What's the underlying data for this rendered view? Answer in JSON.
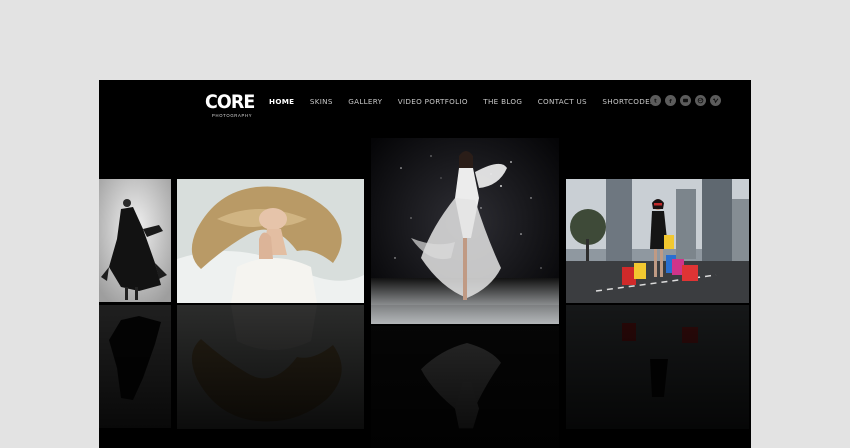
{
  "logo": {
    "word": "CORE",
    "tagline": "PHOTOGRAPHY"
  },
  "nav": {
    "items": [
      {
        "label": "HOME",
        "active": true
      },
      {
        "label": "SKINS",
        "active": false
      },
      {
        "label": "GALLERY",
        "active": false
      },
      {
        "label": "VIDEO PORTFOLIO",
        "active": false
      },
      {
        "label": "THE BLOG",
        "active": false
      },
      {
        "label": "CONTACT US",
        "active": false
      },
      {
        "label": "SHORTCODES",
        "active": false
      }
    ]
  },
  "social": [
    "tumblr-icon",
    "facebook-icon",
    "flickr-icon",
    "dribbble-icon",
    "vimeo-icon"
  ],
  "gallery": [
    {
      "name": "dancer-photo",
      "subject": "woman in black dress dissolving"
    },
    {
      "name": "blonde-woman-photo",
      "subject": "woman with flowing blonde hair lying back"
    },
    {
      "name": "white-dress-photo",
      "subject": "woman in white dress in starry darkness",
      "featured": true
    },
    {
      "name": "shopping-woman-photo",
      "subject": "woman with shopping bags on city street"
    }
  ],
  "colors": {
    "page_bg": "#e3e3e3",
    "site_bg": "#000000",
    "nav_active": "#ffffff",
    "nav_text": "#c8c8c8",
    "icon_bg": "#5c5c5c"
  }
}
